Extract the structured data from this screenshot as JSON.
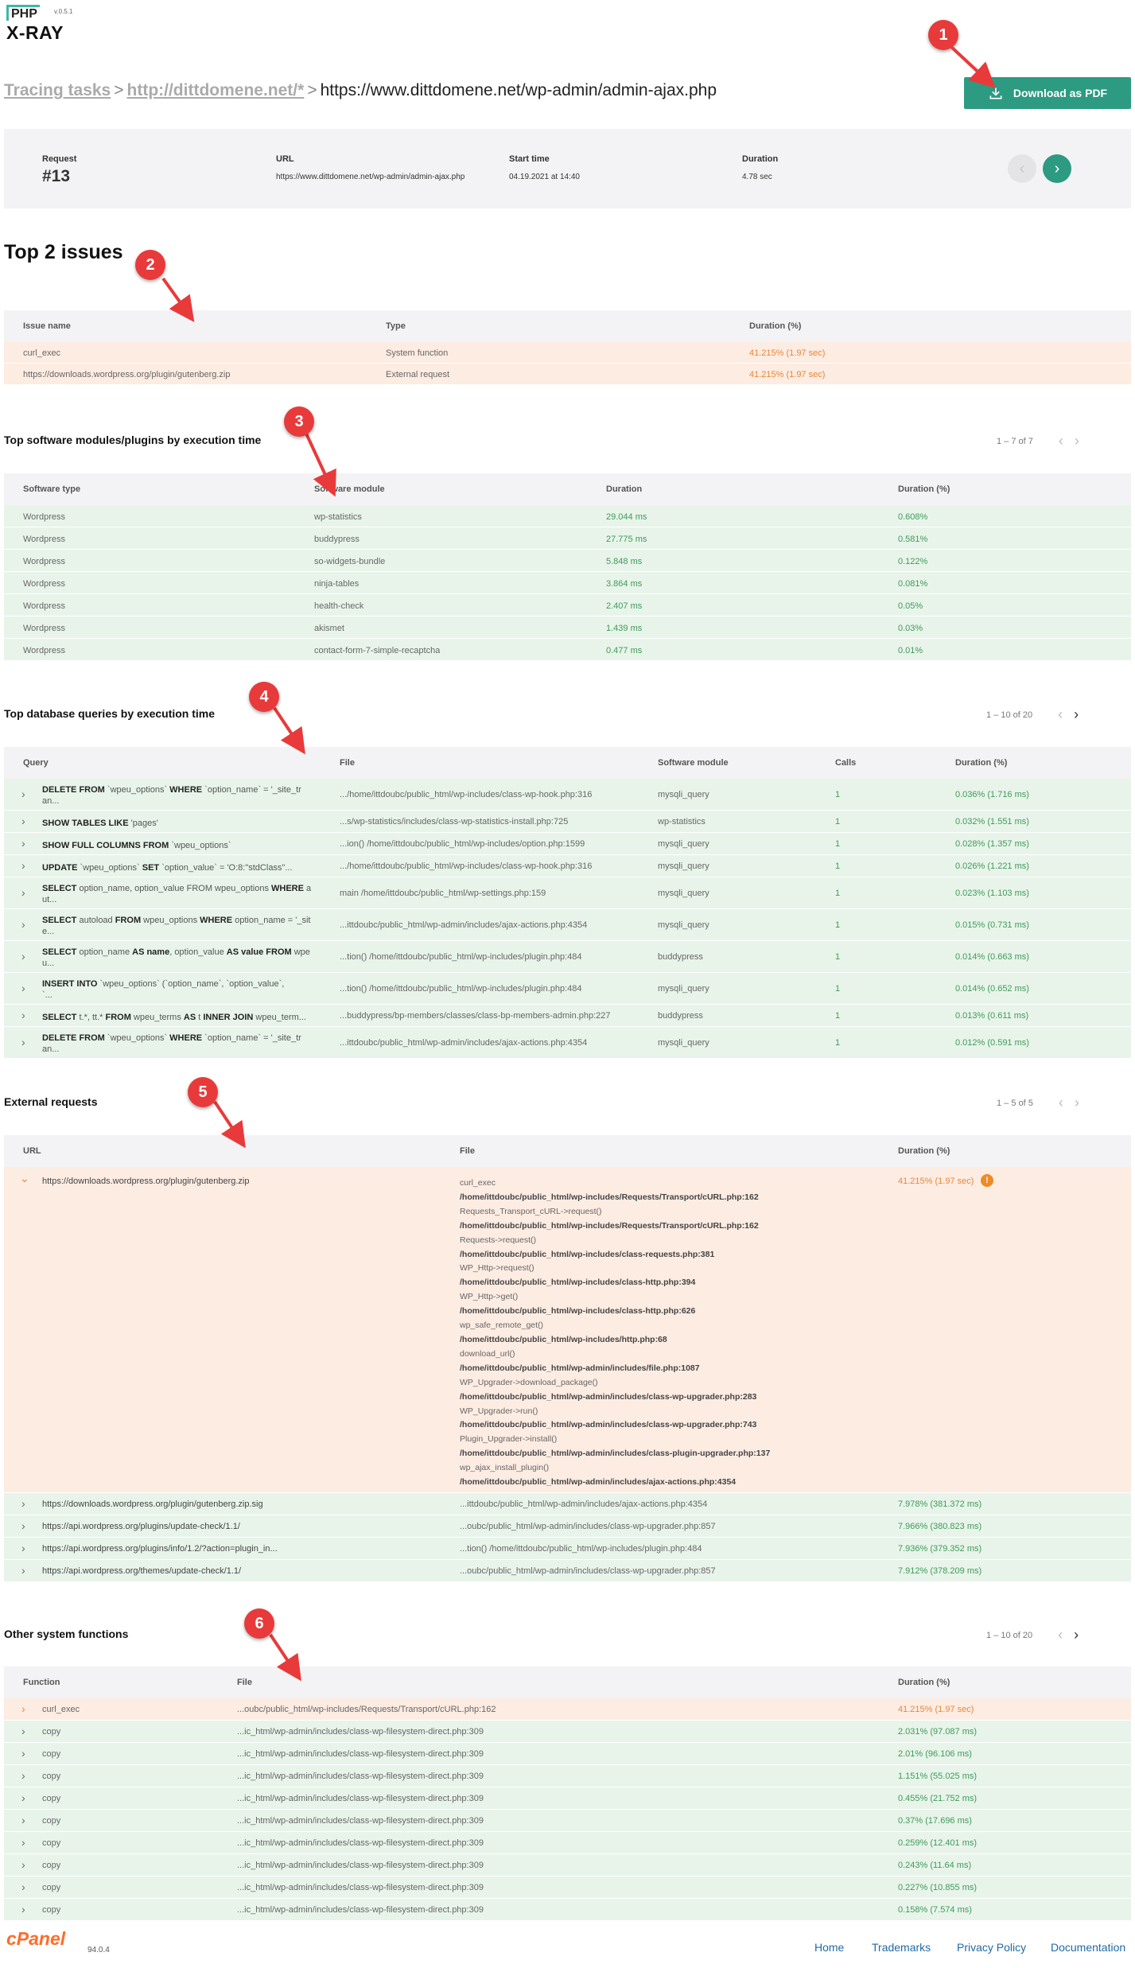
{
  "app": {
    "logo_php": "PHP",
    "logo_xray": "X-RAY",
    "version": "v.0.5.1"
  },
  "breadcrumb": {
    "tasks": "Tracing tasks",
    "domain": "http://dittdomene.net/*",
    "current": "https://www.dittdomene.net/wp-admin/admin-ajax.php",
    "separator": ">"
  },
  "toolbar": {
    "download_pdf": "Download as PDF"
  },
  "request": {
    "labels": {
      "request": "Request",
      "url": "URL",
      "start": "Start time",
      "duration": "Duration"
    },
    "number": "#13",
    "url": "https://www.dittdomene.net/wp-admin/admin-ajax.php",
    "start": "04.19.2021 at 14:40",
    "duration": "4.78 sec"
  },
  "issues": {
    "title": "Top 2 issues",
    "headers": [
      "Issue name",
      "Type",
      "Duration (%)"
    ],
    "rows": [
      [
        "curl_exec",
        "System function",
        "41.215% (1.97 sec)"
      ],
      [
        "https://downloads.wordpress.org/plugin/gutenberg.zip",
        "External request",
        "41.215% (1.97 sec)"
      ]
    ]
  },
  "modules": {
    "title": "Top software modules/plugins by execution time",
    "pager": "1 – 7 of 7",
    "headers": [
      "Software type",
      "Software module",
      "Duration",
      "Duration (%)"
    ],
    "rows": [
      [
        "Wordpress",
        "wp-statistics",
        "29.044 ms",
        "0.608%"
      ],
      [
        "Wordpress",
        "buddypress",
        "27.775 ms",
        "0.581%"
      ],
      [
        "Wordpress",
        "so-widgets-bundle",
        "5.848 ms",
        "0.122%"
      ],
      [
        "Wordpress",
        "ninja-tables",
        "3.864 ms",
        "0.081%"
      ],
      [
        "Wordpress",
        "health-check",
        "2.407 ms",
        "0.05%"
      ],
      [
        "Wordpress",
        "akismet",
        "1.439 ms",
        "0.03%"
      ],
      [
        "Wordpress",
        "contact-form-7-simple-recaptcha",
        "0.477 ms",
        "0.01%"
      ]
    ]
  },
  "queries": {
    "title": "Top database queries by execution time",
    "pager": "1 – 10 of 20",
    "headers": [
      "Query",
      "File",
      "Software module",
      "Calls",
      "Duration (%)"
    ],
    "rows": [
      {
        "q1": "<b>DELETE FROM</b> `wpeu_options` <b>WHERE</b> `option_name` = '_site_tr",
        "q2": "an...",
        "file": ".../home/ittdoubc/public_html/wp-includes/class-wp-hook.php:316",
        "module": "mysqli_query",
        "calls": "1",
        "dur": "0.036% (1.716 ms)"
      },
      {
        "q1": "<b>SHOW TABLES LIKE</b> 'pages'",
        "q2": "",
        "file": "...s/wp-statistics/includes/class-wp-statistics-install.php:725",
        "module": "wp-statistics",
        "calls": "1",
        "dur": "0.032% (1.551 ms)"
      },
      {
        "q1": "<b>SHOW FULL COLUMNS FROM</b> `wpeu_options`",
        "q2": "",
        "file": "...ion() /home/ittdoubc/public_html/wp-includes/option.php:1599",
        "module": "mysqli_query",
        "calls": "1",
        "dur": "0.028% (1.357 ms)"
      },
      {
        "q1": "<b>UPDATE</b> `wpeu_options` <b>SET</b> `option_value` = 'O:8:\"stdClass\"...",
        "q2": "",
        "file": ".../home/ittdoubc/public_html/wp-includes/class-wp-hook.php:316",
        "module": "mysqli_query",
        "calls": "1",
        "dur": "0.026% (1.221 ms)"
      },
      {
        "q1": "<b>SELECT</b> option_name, option_value FROM wpeu_options <b>WHERE</b> a",
        "q2": "ut...",
        "file": "main /home/ittdoubc/public_html/wp-settings.php:159",
        "module": "mysqli_query",
        "calls": "1",
        "dur": "0.023% (1.103 ms)"
      },
      {
        "q1": "<b>SELECT</b> autoload <b>FROM</b> wpeu_options <b>WHERE</b> option_name = '_sit",
        "q2": "e...",
        "file": "...ittdoubc/public_html/wp-admin/includes/ajax-actions.php:4354",
        "module": "mysqli_query",
        "calls": "1",
        "dur": "0.015% (0.731 ms)"
      },
      {
        "q1": "<b>SELECT</b> option_name <b>AS name</b>, option_value <b>AS value FROM</b> wpe",
        "q2": "u...",
        "file": "...tion() /home/ittdoubc/public_html/wp-includes/plugin.php:484",
        "module": "buddypress",
        "calls": "1",
        "dur": "0.014% (0.663 ms)"
      },
      {
        "q1": "<b>INSERT INTO</b> `wpeu_options` (`option_name`, `option_value`,",
        "q2": "`...",
        "file": "...tion() /home/ittdoubc/public_html/wp-includes/plugin.php:484",
        "module": "mysqli_query",
        "calls": "1",
        "dur": "0.014% (0.652 ms)"
      },
      {
        "q1": "<b>SELECT</b> t.*, tt.* <b>FROM</b> wpeu_terms <b>AS</b> t <b>INNER JOIN</b> wpeu_term...",
        "q2": "",
        "file": "...buddypress/bp-members/classes/class-bp-members-admin.php:227",
        "module": "buddypress",
        "calls": "1",
        "dur": "0.013% (0.611 ms)"
      },
      {
        "q1": "<b>DELETE FROM</b> `wpeu_options` <b>WHERE</b> `option_name` = '_site_tr",
        "q2": "an...",
        "file": "...ittdoubc/public_html/wp-admin/includes/ajax-actions.php:4354",
        "module": "mysqli_query",
        "calls": "1",
        "dur": "0.012% (0.591 ms)"
      }
    ]
  },
  "external": {
    "title": "External requests",
    "pager": "1 – 5 of 5",
    "headers": [
      "URL",
      "File",
      "Duration (%)"
    ],
    "expanded": {
      "url": "https://downloads.wordpress.org/plugin/gutenberg.zip",
      "dur": "41.215% (1.97 sec)",
      "trace": [
        {
          "t": "curl_exec",
          "b": false
        },
        {
          "t": "/home/ittdoubc/public_html/wp-includes/Requests/Transport/cURL.php:162",
          "b": true
        },
        {
          "t": "Requests_Transport_cURL->request()",
          "b": false
        },
        {
          "t": "/home/ittdoubc/public_html/wp-includes/Requests/Transport/cURL.php:162",
          "b": true
        },
        {
          "t": "Requests->request()",
          "b": false
        },
        {
          "t": "/home/ittdoubc/public_html/wp-includes/class-requests.php:381",
          "b": true
        },
        {
          "t": "WP_Http->request()",
          "b": false
        },
        {
          "t": "/home/ittdoubc/public_html/wp-includes/class-http.php:394",
          "b": true
        },
        {
          "t": "WP_Http->get()",
          "b": false
        },
        {
          "t": "/home/ittdoubc/public_html/wp-includes/class-http.php:626",
          "b": true
        },
        {
          "t": "wp_safe_remote_get()",
          "b": false
        },
        {
          "t": "/home/ittdoubc/public_html/wp-includes/http.php:68",
          "b": true
        },
        {
          "t": "download_url()",
          "b": false
        },
        {
          "t": "/home/ittdoubc/public_html/wp-admin/includes/file.php:1087",
          "b": true
        },
        {
          "t": "WP_Upgrader->download_package()",
          "b": false
        },
        {
          "t": "/home/ittdoubc/public_html/wp-admin/includes/class-wp-upgrader.php:283",
          "b": true
        },
        {
          "t": "WP_Upgrader->run()",
          "b": false
        },
        {
          "t": "/home/ittdoubc/public_html/wp-admin/includes/class-wp-upgrader.php:743",
          "b": true
        },
        {
          "t": "Plugin_Upgrader->install()",
          "b": false
        },
        {
          "t": "/home/ittdoubc/public_html/wp-admin/includes/class-plugin-upgrader.php:137",
          "b": true
        },
        {
          "t": "wp_ajax_install_plugin()",
          "b": false
        },
        {
          "t": "/home/ittdoubc/public_html/wp-admin/includes/ajax-actions.php:4354",
          "b": true
        }
      ]
    },
    "rows": [
      [
        "https://downloads.wordpress.org/plugin/gutenberg.zip.sig",
        "...ittdoubc/public_html/wp-admin/includes/ajax-actions.php:4354",
        "7.978% (381.372 ms)"
      ],
      [
        "https://api.wordpress.org/plugins/update-check/1.1/",
        "...oubc/public_html/wp-admin/includes/class-wp-upgrader.php:857",
        "7.966% (380.823 ms)"
      ],
      [
        "https://api.wordpress.org/plugins/info/1.2/?action=plugin_in...",
        "...tion() /home/ittdoubc/public_html/wp-includes/plugin.php:484",
        "7.936% (379.352 ms)"
      ],
      [
        "https://api.wordpress.org/themes/update-check/1.1/",
        "...oubc/public_html/wp-admin/includes/class-wp-upgrader.php:857",
        "7.912% (378.209 ms)"
      ]
    ]
  },
  "sysfuncs": {
    "title": "Other system functions",
    "pager": "1 – 10 of 20",
    "headers": [
      "Function",
      "File",
      "Duration (%)"
    ],
    "rows": [
      [
        "curl_exec",
        "...oubc/public_html/wp-includes/Requests/Transport/cURL.php:162",
        "41.215% (1.97 sec)"
      ],
      [
        "copy",
        "...ic_html/wp-admin/includes/class-wp-filesystem-direct.php:309",
        "2.031% (97.087 ms)"
      ],
      [
        "copy",
        "...ic_html/wp-admin/includes/class-wp-filesystem-direct.php:309",
        "2.01% (96.106 ms)"
      ],
      [
        "copy",
        "...ic_html/wp-admin/includes/class-wp-filesystem-direct.php:309",
        "1.151% (55.025 ms)"
      ],
      [
        "copy",
        "...ic_html/wp-admin/includes/class-wp-filesystem-direct.php:309",
        "0.455% (21.752 ms)"
      ],
      [
        "copy",
        "...ic_html/wp-admin/includes/class-wp-filesystem-direct.php:309",
        "0.37% (17.696 ms)"
      ],
      [
        "copy",
        "...ic_html/wp-admin/includes/class-wp-filesystem-direct.php:309",
        "0.259% (12.401 ms)"
      ],
      [
        "copy",
        "...ic_html/wp-admin/includes/class-wp-filesystem-direct.php:309",
        "0.243% (11.64 ms)"
      ],
      [
        "copy",
        "...ic_html/wp-admin/includes/class-wp-filesystem-direct.php:309",
        "0.227% (10.855 ms)"
      ],
      [
        "copy",
        "...ic_html/wp-admin/includes/class-wp-filesystem-direct.php:309",
        "0.158% (7.574 ms)"
      ]
    ]
  },
  "markers": [
    "1",
    "2",
    "3",
    "4",
    "5",
    "6"
  ],
  "footer": {
    "brand": "cPanel",
    "version": "94.0.4",
    "links": [
      "Home",
      "Trademarks",
      "Privacy Policy",
      "Documentation"
    ]
  },
  "colors": {
    "accent": "#2d9a82",
    "good": "#3f9a5a",
    "warning": "#e8873b",
    "marker": "#e83a3a"
  }
}
